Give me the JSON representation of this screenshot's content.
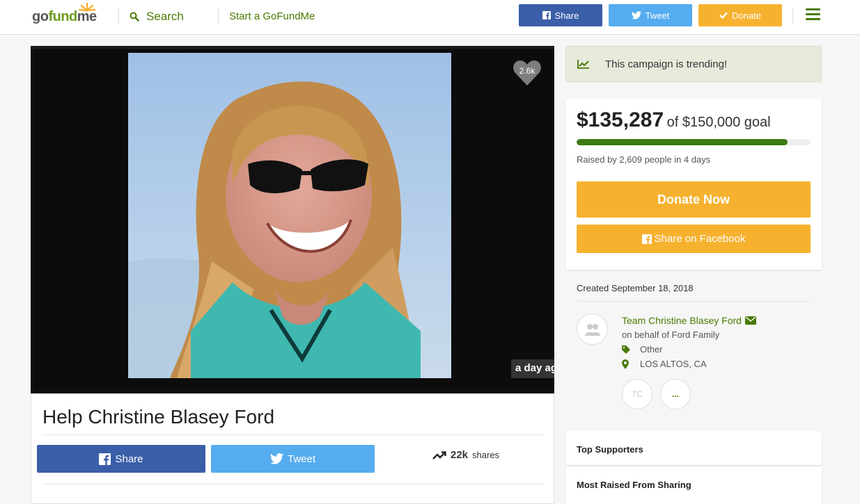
{
  "header": {
    "logo": "gofundme",
    "search_label": "Search",
    "start_label": "Start a GoFundMe",
    "share_label": "Share",
    "tweet_label": "Tweet",
    "donate_label": "Donate"
  },
  "media": {
    "heart_count": "2.6k",
    "time_badge": "a day ago"
  },
  "campaign": {
    "title": "Help Christine Blasey Ford",
    "share_label": "Share",
    "tweet_label": "Tweet",
    "shares_count": "22k",
    "shares_label": "shares"
  },
  "sidebar": {
    "trending": "This campaign is trending!",
    "amount": "$135,287",
    "goal": "of $150,000 goal",
    "progress": 0.902,
    "raised_by": "Raised by 2,609 people in 4 days",
    "donate_now": "Donate Now",
    "share_facebook": "Share on Facebook",
    "created": "Created September 18, 2018",
    "organizer": "Team Christine Blasey Ford",
    "behalf": "on behalf of Ford Family",
    "category": "Other",
    "location": "LOS ALTOS, CA",
    "team_initials": "TC",
    "more": "...",
    "top_supporters": "Top Supporters",
    "most_raised": "Most Raised From Sharing"
  },
  "colors": {
    "brand_green": "#4a7a00",
    "facebook": "#3b5ea8",
    "twitter": "#55acee",
    "donate": "#f6b22f",
    "progress": "#3c7a14"
  }
}
